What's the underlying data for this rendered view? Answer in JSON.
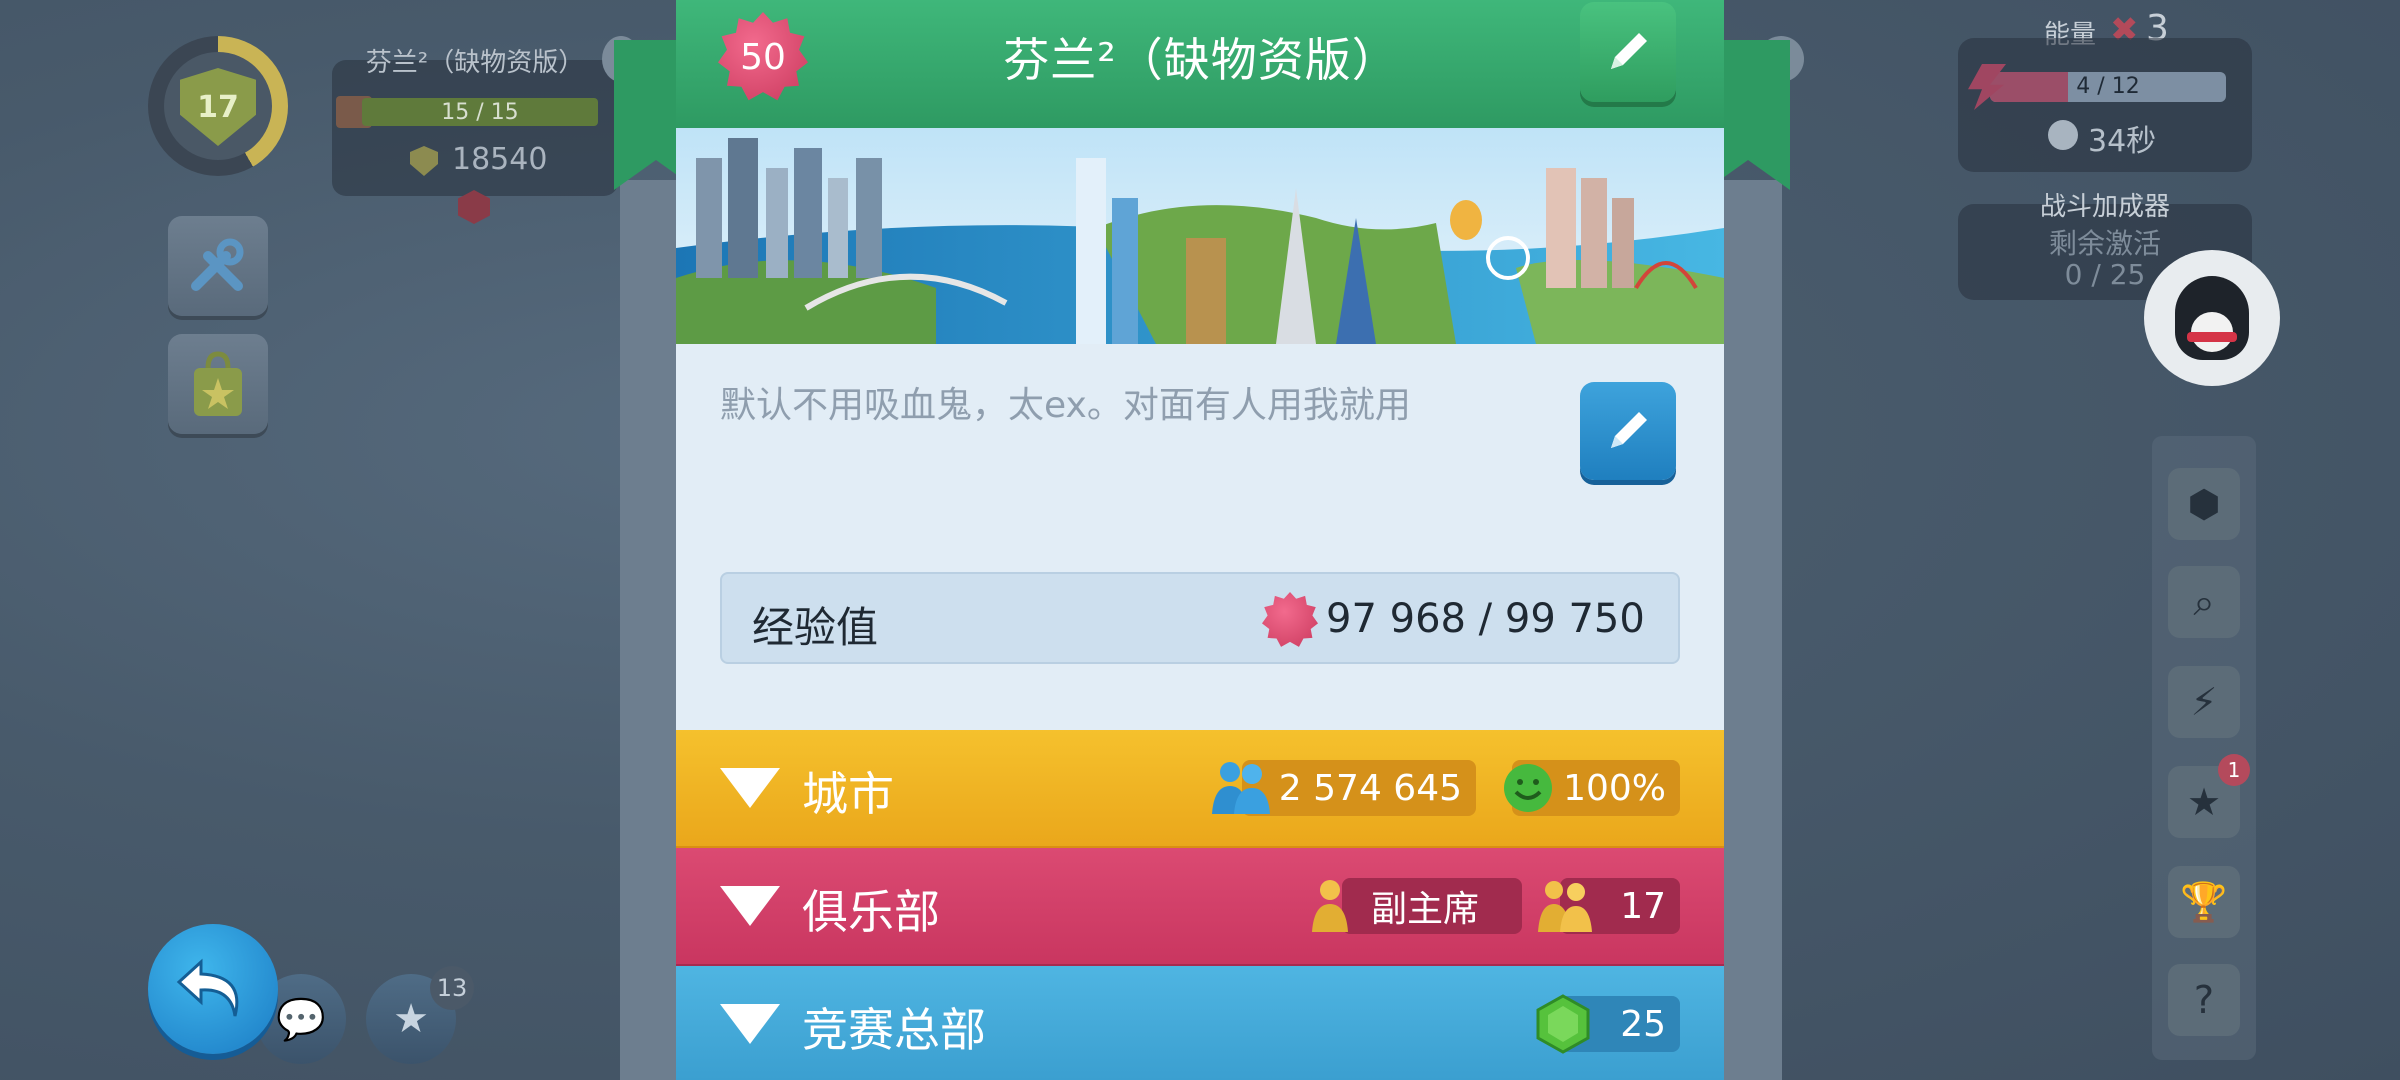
{
  "hud": {
    "player_level": "17",
    "city_name": "芬兰²（缺物资版）",
    "population_bar": "15 / 15",
    "simcash": "18540",
    "energy_title": "能量",
    "energy_multiplier": "3",
    "energy_bar": "4 / 12",
    "energy_fraction": 0.33,
    "energy_timer": "34秒",
    "boost_title": "战斗加成器",
    "boost_subtitle": "剩余激活",
    "boost_count": "0 / 25",
    "rail_badge": "1",
    "star_badge": "13"
  },
  "profile": {
    "level": "50",
    "title": "芬兰²（缺物资版）",
    "description": "默认不用吸血鬼，太ex。对面有人用我就用",
    "xp_label": "经验值",
    "xp_value": "97 968 / 99 750"
  },
  "sections": {
    "city": {
      "label": "城市",
      "population": "2 574 645",
      "happiness": "100%"
    },
    "club": {
      "label": "俱乐部",
      "role": "副主席",
      "members": "17"
    },
    "hq": {
      "label": "竞赛总部",
      "value": "25"
    }
  },
  "colors": {
    "header_green": "#2e9a62",
    "city_yellow": "#f5c12d",
    "club_pink": "#c93660",
    "hq_blue": "#4fb5e2"
  }
}
